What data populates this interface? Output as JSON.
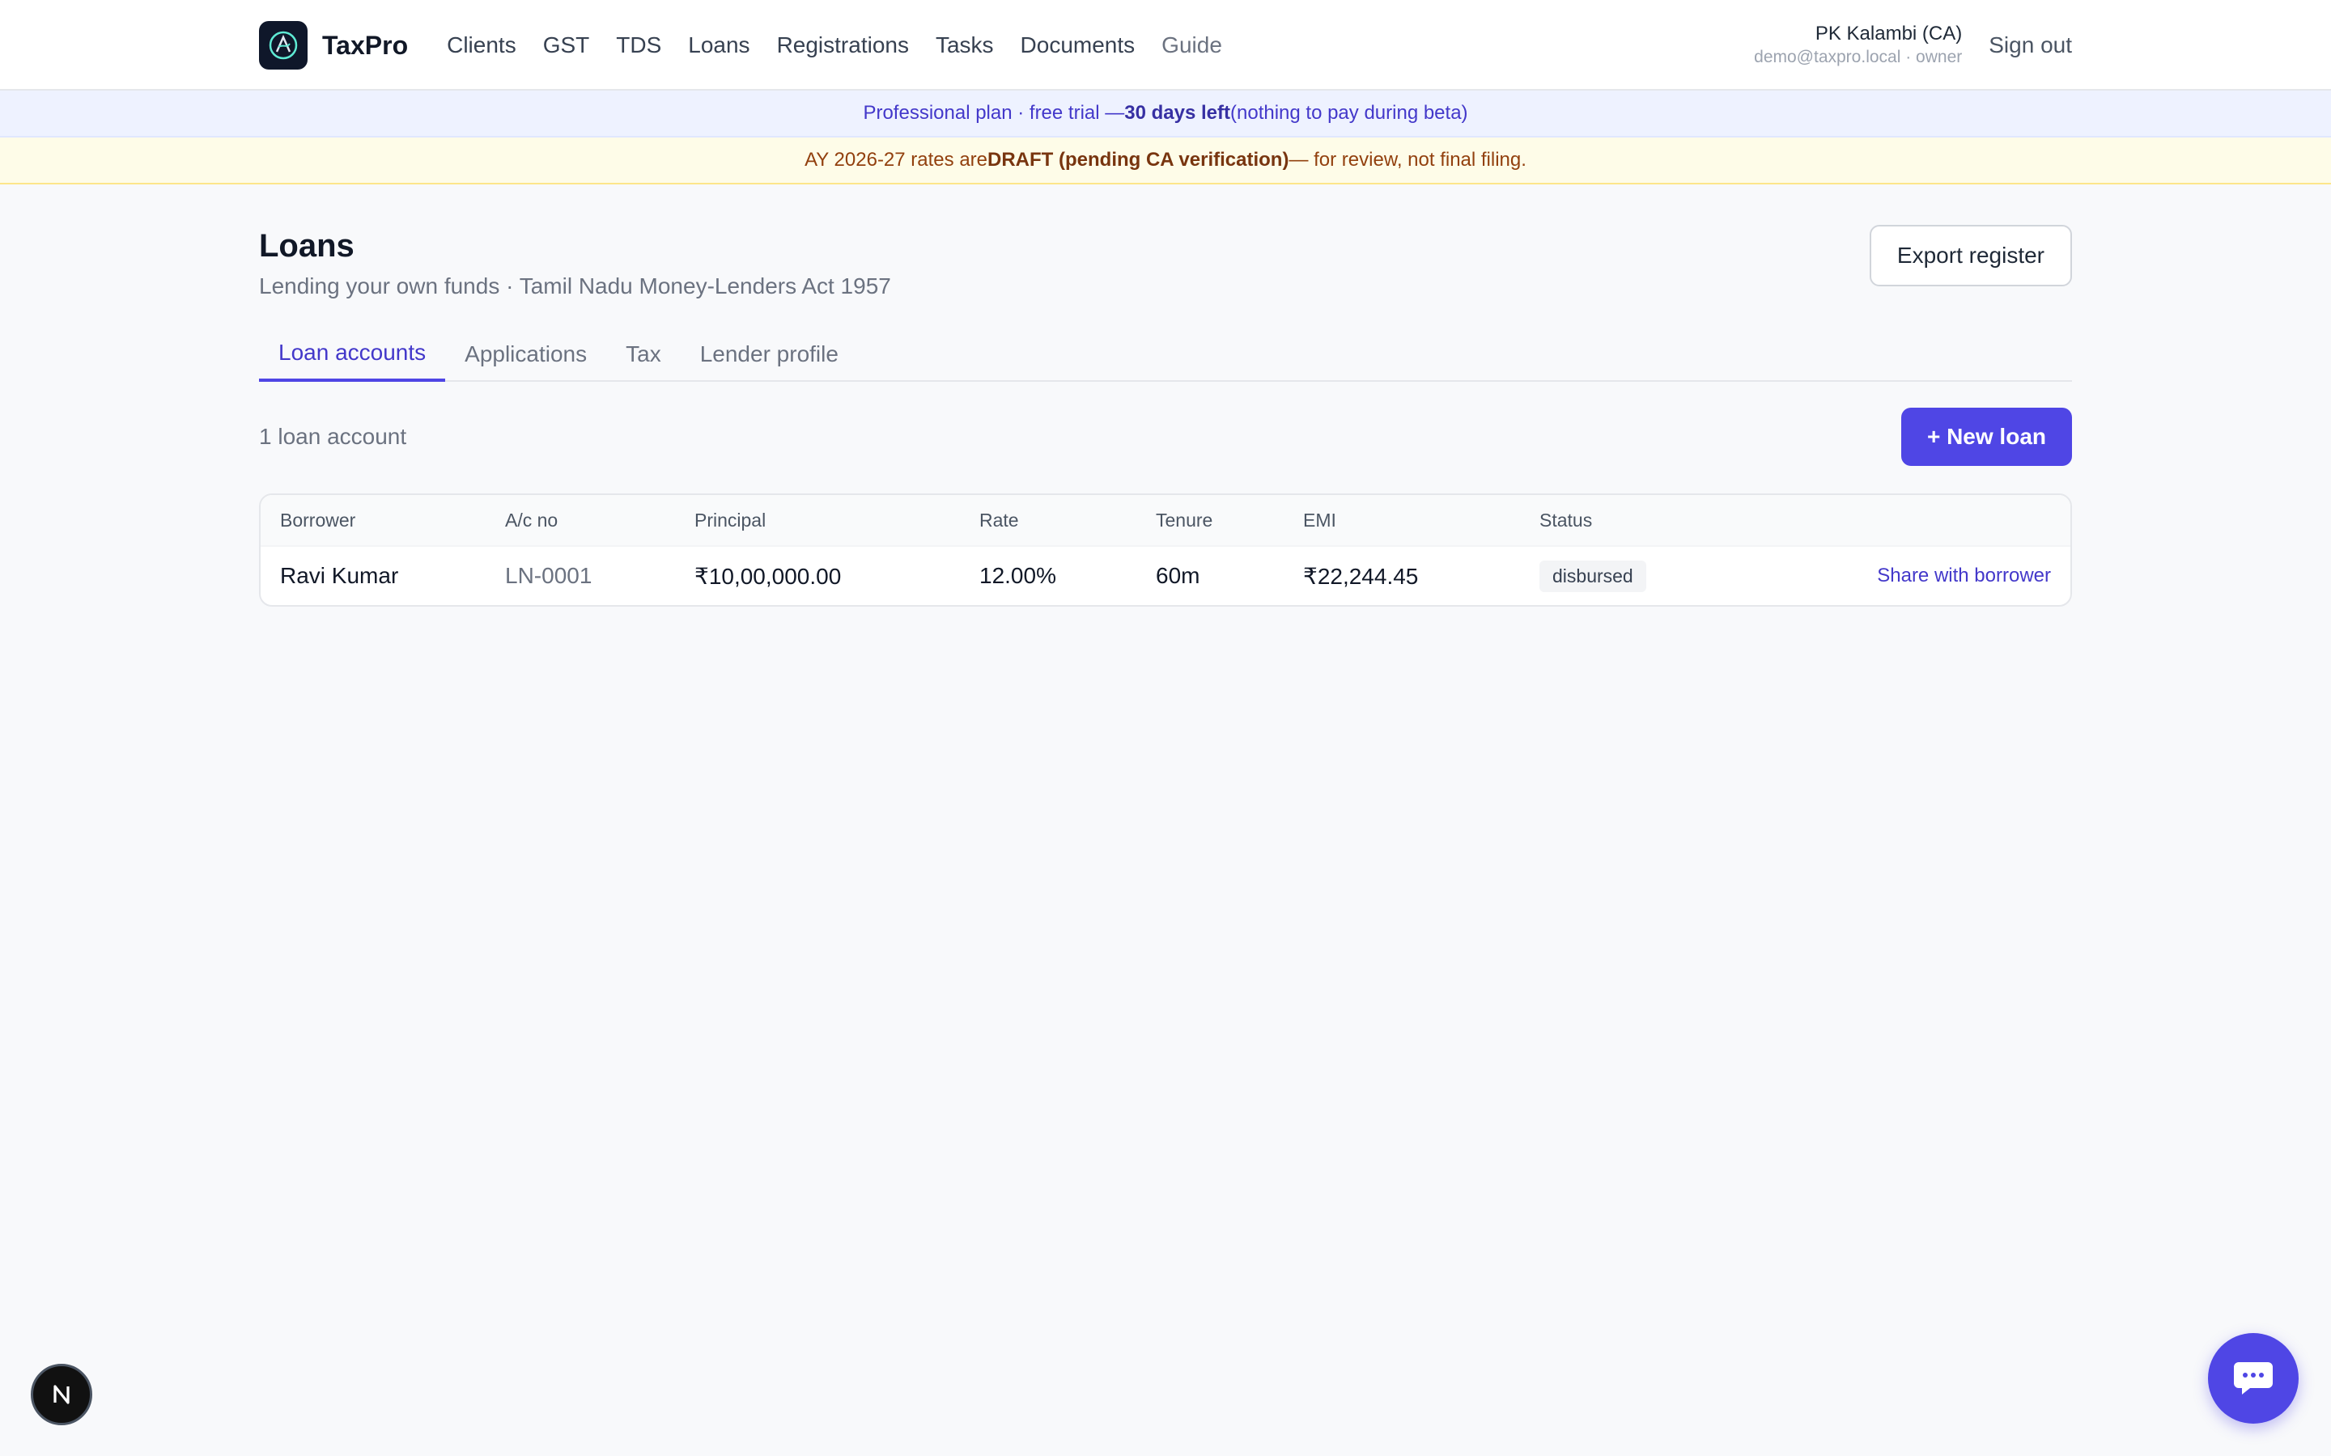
{
  "app": {
    "brand": "TaxPro"
  },
  "nav": {
    "items": [
      "Clients",
      "GST",
      "TDS",
      "Loans",
      "Registrations",
      "Tasks",
      "Documents",
      "Guide"
    ]
  },
  "user": {
    "name": "PK Kalambi (CA)",
    "email_role": "demo@taxpro.local · owner",
    "signout_label": "Sign out"
  },
  "banners": {
    "plan_prefix": "Professional plan · free trial — ",
    "plan_bold": "30 days left",
    "plan_suffix": " (nothing to pay during beta)",
    "draft_prefix": "AY 2026-27 rates are ",
    "draft_bold": "DRAFT (pending CA verification)",
    "draft_suffix": " — for review, not final filing."
  },
  "page": {
    "title": "Loans",
    "subtitle": "Lending your own funds · Tamil Nadu Money-Lenders Act 1957",
    "export_label": "Export register"
  },
  "tabs": [
    "Loan accounts",
    "Applications",
    "Tax",
    "Lender profile"
  ],
  "list": {
    "count_text": "1 loan account",
    "new_label": "+ New loan"
  },
  "table": {
    "columns": [
      "Borrower",
      "A/c no",
      "Principal",
      "Rate",
      "Tenure",
      "EMI",
      "Status"
    ],
    "rows": [
      {
        "borrower": "Ravi Kumar",
        "acno": "LN-0001",
        "principal": "₹10,00,000.00",
        "rate": "12.00%",
        "tenure": "60m",
        "emi": "₹22,244.45",
        "status": "disbursed",
        "action": "Share with borrower"
      }
    ]
  },
  "colors": {
    "accent": "#4f46e5",
    "plan_banner_bg": "#eef2ff",
    "draft_banner_bg": "#fefce8"
  },
  "icons": {
    "logo": "taxpro-logo-icon",
    "dev": "nextjs-n-icon",
    "chat": "chat-bubble-icon"
  }
}
